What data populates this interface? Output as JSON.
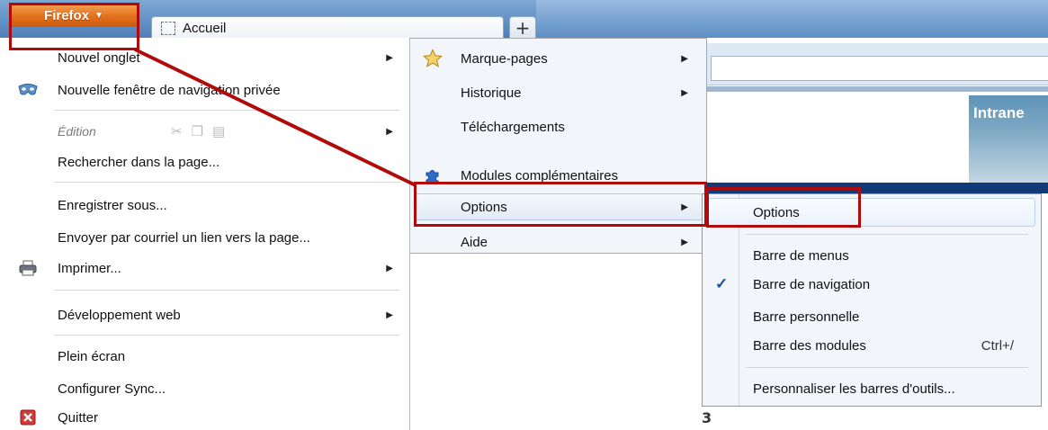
{
  "browser": {
    "firefox_button": "Firefox",
    "tab_title": "Accueil",
    "new_tab": "+",
    "page_banner": "Intrane",
    "page_fragment": "3"
  },
  "main_menu": {
    "items": [
      {
        "label": "Nouvel onglet",
        "submenu": true
      },
      {
        "label": "Nouvelle fenêtre de navigation privée",
        "icon": "private-mask-icon"
      },
      {
        "label": "Édition",
        "submenu": true,
        "disabled": true,
        "icons": [
          "cut-icon",
          "copy-icon",
          "paste-icon"
        ]
      },
      {
        "label": "Rechercher dans la page..."
      },
      {
        "label": "Enregistrer sous..."
      },
      {
        "label": "Envoyer par courriel un lien vers la page..."
      },
      {
        "label": "Imprimer...",
        "submenu": true,
        "icon": "printer-icon"
      },
      {
        "label": "Développement web",
        "submenu": true
      },
      {
        "label": "Plein écran"
      },
      {
        "label": "Configurer Sync..."
      },
      {
        "label": "Quitter",
        "icon": "quit-icon"
      }
    ]
  },
  "sub_menu": {
    "items": [
      {
        "label": "Marque-pages",
        "submenu": true,
        "icon": "star-icon"
      },
      {
        "label": "Historique",
        "submenu": true
      },
      {
        "label": "Téléchargements"
      },
      {
        "label": "Modules complémentaires",
        "icon": "puzzle-icon"
      },
      {
        "label": "Options",
        "submenu": true,
        "highlighted": true
      },
      {
        "label": "Aide",
        "submenu": true
      }
    ]
  },
  "options_menu": {
    "items": [
      {
        "label": "Options",
        "highlighted": true
      },
      {
        "label": "Barre de menus"
      },
      {
        "label": "Barre de navigation",
        "checked": true
      },
      {
        "label": "Barre personnelle"
      },
      {
        "label": "Barre des modules",
        "accel": "Ctrl+/"
      },
      {
        "label": "Personnaliser les barres d'outils..."
      }
    ]
  },
  "colors": {
    "annotation": "#b00a0a",
    "firefox_orange": "#e3701a",
    "check": "#1b4fa0"
  }
}
